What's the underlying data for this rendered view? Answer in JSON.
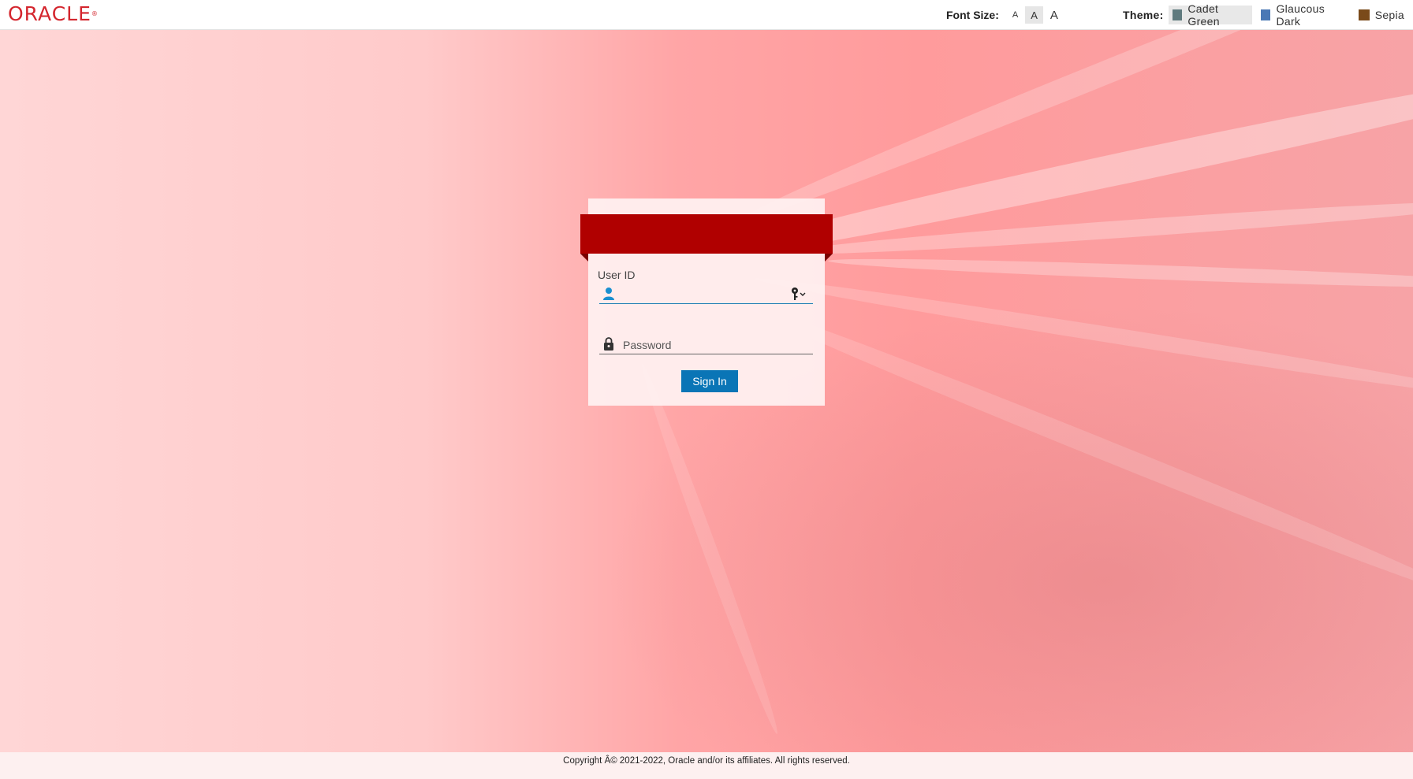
{
  "header": {
    "logo_text": "ORACLE",
    "logo_mark": "®",
    "font_size": {
      "label": "Font Size:",
      "options": [
        "A",
        "A",
        "A"
      ],
      "selected_index": 1
    },
    "theme": {
      "label": "Theme:",
      "options": [
        {
          "label": "Cadet Green",
          "color": "#5f7a7e",
          "active": true
        },
        {
          "label": "Glaucous Dark",
          "color": "#4a78b5",
          "active": false
        },
        {
          "label": "Sepia",
          "color": "#7a4a1a",
          "active": false
        }
      ]
    }
  },
  "login": {
    "banner_color": "#b00000",
    "user_id_label": "User ID",
    "user_id_value": "",
    "password_placeholder": "Password",
    "sign_in_label": "Sign In",
    "sign_in_color": "#0a75b6"
  },
  "footer": {
    "copyright": "Copyright Â© 2021-2022, Oracle and/or its affiliates. All rights reserved."
  }
}
